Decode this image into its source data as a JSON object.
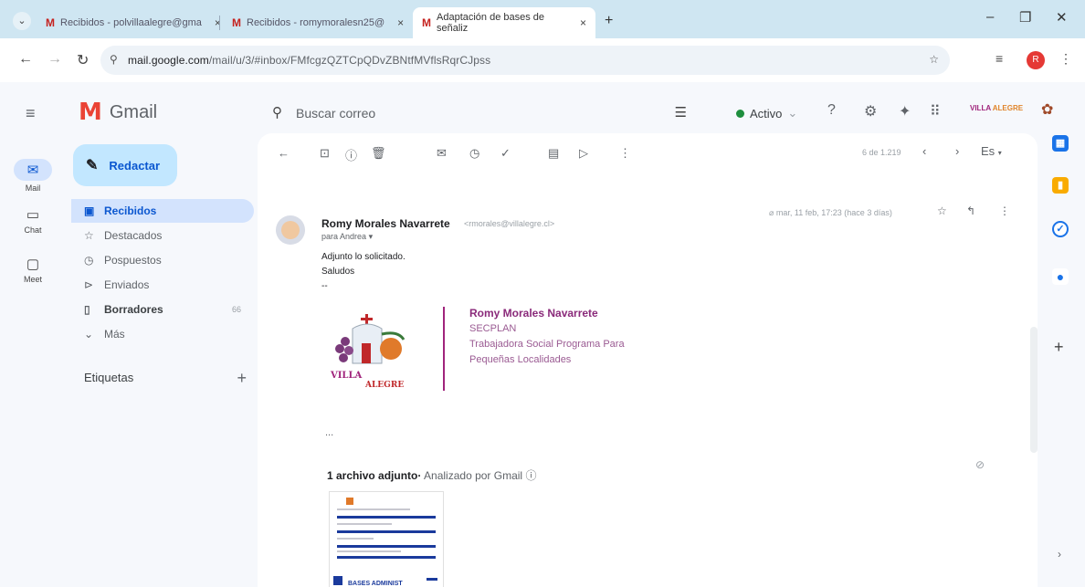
{
  "browser": {
    "tab_menu_icon": "chevron-down-icon",
    "tabs": [
      {
        "label": "Recibidos - polvillaalegre@gma",
        "close": "×"
      },
      {
        "label": "Recibidos - romymoralesn25@",
        "close": "×"
      },
      {
        "label": "Adaptación de bases de señaliz",
        "close": "×"
      }
    ],
    "newtab": "+",
    "window_controls": {
      "minimize": "–",
      "maximize": "❐",
      "close": "✕"
    },
    "url_host": "mail.google.com",
    "url_path": "/mail/u/3/#inbox/FMfcgzQZTCpQDvZBNtfMVflsRqrCJpss",
    "profile_initial": "R"
  },
  "gmail": {
    "brand": "Gmail",
    "search_placeholder": "Buscar correo",
    "status_label": "Activo",
    "header_brand_line1": "VILLA",
    "header_brand_line2": "ALEGRE",
    "rail": [
      {
        "label": "Mail",
        "icon": "mail-icon"
      },
      {
        "label": "Chat",
        "icon": "chat-icon"
      },
      {
        "label": "Meet",
        "icon": "video-icon"
      }
    ],
    "compose_label": "Redactar",
    "nav": [
      {
        "label": "Recibidos",
        "icon": "inbox-icon",
        "count": ""
      },
      {
        "label": "Destacados",
        "icon": "star-icon",
        "count": ""
      },
      {
        "label": "Pospuestos",
        "icon": "clock-icon",
        "count": ""
      },
      {
        "label": "Enviados",
        "icon": "send-icon",
        "count": ""
      },
      {
        "label": "Borradores",
        "icon": "draft-icon",
        "count": "66"
      },
      {
        "label": "Más",
        "icon": "chevron-down-icon",
        "count": ""
      }
    ],
    "labels_heading": "Etiquetas",
    "pager_text": "6 de 1.219",
    "lang_label": "Es",
    "message": {
      "sender_name": "Romy Morales Navarrete",
      "sender_email": "<rmorales@villalegre.cl>",
      "to_line": "para Andrea",
      "date_line": "mar, 11 feb, 17:23 (hace 3 días)",
      "body_line1": "Adjunto lo solicitado.",
      "body_line2": "Saludos",
      "body_line3": "--",
      "signature": {
        "name": "Romy Morales Navarrete",
        "dept": "SECPLAN",
        "role_line1": "Trabajadora Social Programa Para",
        "role_line2": "Pequeñas Localidades",
        "logo_text_top": "VILLA",
        "logo_text_bottom": "ALEGRE"
      },
      "ellipsis": "...",
      "attachments_count_text": "1 archivo adjunto",
      "attachments_scan_text": "Analizado por Gmail",
      "thumb_caption": "BASES ADMINIST"
    }
  }
}
